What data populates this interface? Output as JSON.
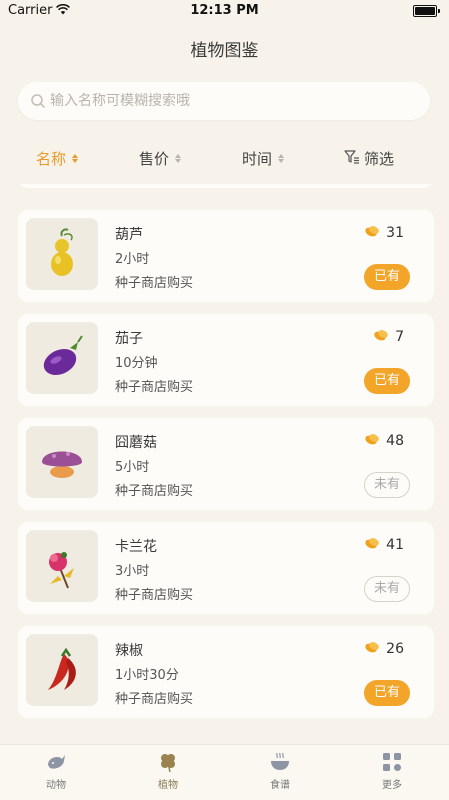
{
  "status_bar": {
    "carrier": "Carrier",
    "time": "12:13 PM"
  },
  "header": {
    "title": "植物图鉴"
  },
  "search": {
    "placeholder": "输入名称可模糊搜索哦",
    "value": ""
  },
  "sort": {
    "name": "名称",
    "price": "售价",
    "time": "时间",
    "filter": "筛选",
    "active": "name"
  },
  "plants": [
    {
      "name": "葫芦",
      "duration": "2小时",
      "source": "种子商店购买",
      "price": "31",
      "status": "已有",
      "owned": true,
      "icon": "gourd-icon"
    },
    {
      "name": "茄子",
      "duration": "10分钟",
      "source": "种子商店购买",
      "price": "7",
      "status": "已有",
      "owned": true,
      "icon": "eggplant-icon"
    },
    {
      "name": "囧蘑菇",
      "duration": "5小时",
      "source": "种子商店购买",
      "price": "48",
      "status": "未有",
      "owned": false,
      "icon": "mushroom-icon"
    },
    {
      "name": "卡兰花",
      "duration": "3小时",
      "source": "种子商店购买",
      "price": "41",
      "status": "未有",
      "owned": false,
      "icon": "flower-icon"
    },
    {
      "name": "辣椒",
      "duration": "1小时30分",
      "source": "种子商店购买",
      "price": "26",
      "status": "已有",
      "owned": true,
      "icon": "chili-icon"
    }
  ],
  "tabs": [
    {
      "label": "动物",
      "icon": "whale-icon"
    },
    {
      "label": "植物",
      "icon": "clover-icon",
      "active": true
    },
    {
      "label": "食谱",
      "icon": "bowl-icon"
    },
    {
      "label": "更多",
      "icon": "grid-icon"
    }
  ],
  "colors": {
    "accent": "#f2a528",
    "background": "#f7f3ea",
    "card": "#fdfcf8"
  }
}
